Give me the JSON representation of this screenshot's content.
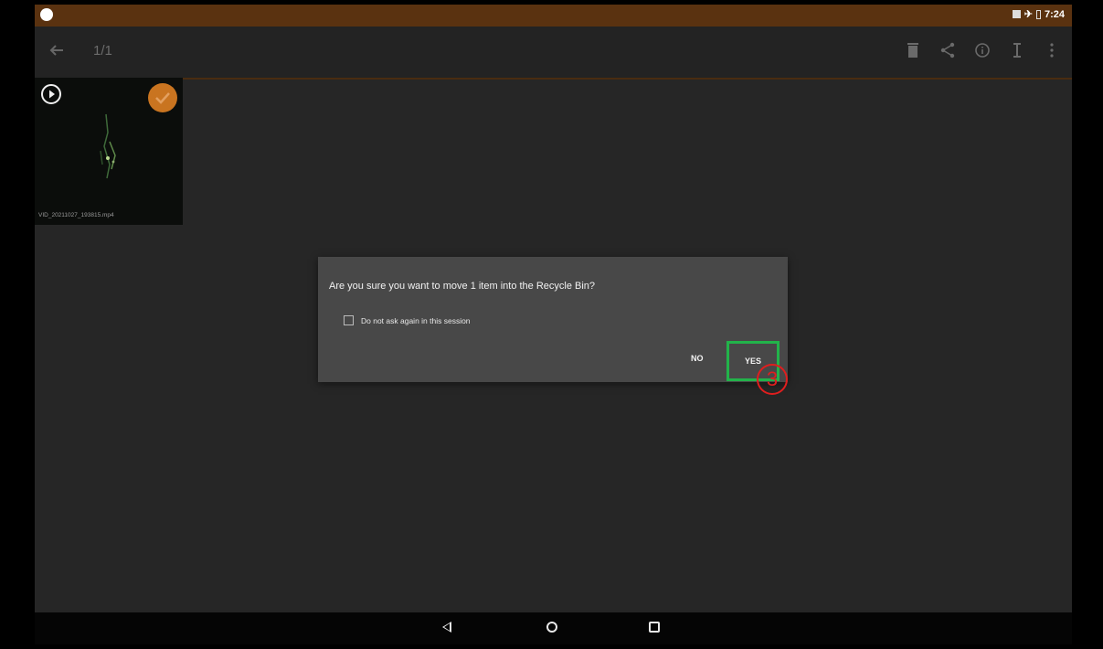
{
  "status_bar": {
    "time": "7:24"
  },
  "toolbar": {
    "counter": "1/1"
  },
  "thumbnail": {
    "filename": "VID_20211027_193815.mp4"
  },
  "dialog": {
    "message": "Are you sure you want to move 1 item into the Recycle Bin?",
    "checkbox_label": "Do not ask again in this session",
    "no_label": "NO",
    "yes_label": "YES"
  },
  "annotation": {
    "step_number": "3",
    "highlight_color": "#22b34a",
    "marker_color": "#e01e1e"
  },
  "colors": {
    "accent": "#c97420",
    "status_bar": "#5a3210"
  },
  "icons": [
    "back-arrow-icon",
    "delete-icon",
    "share-icon",
    "info-icon",
    "more-icon",
    "play-icon",
    "check-icon",
    "nav-back-icon",
    "nav-home-icon",
    "nav-recents-icon"
  ]
}
